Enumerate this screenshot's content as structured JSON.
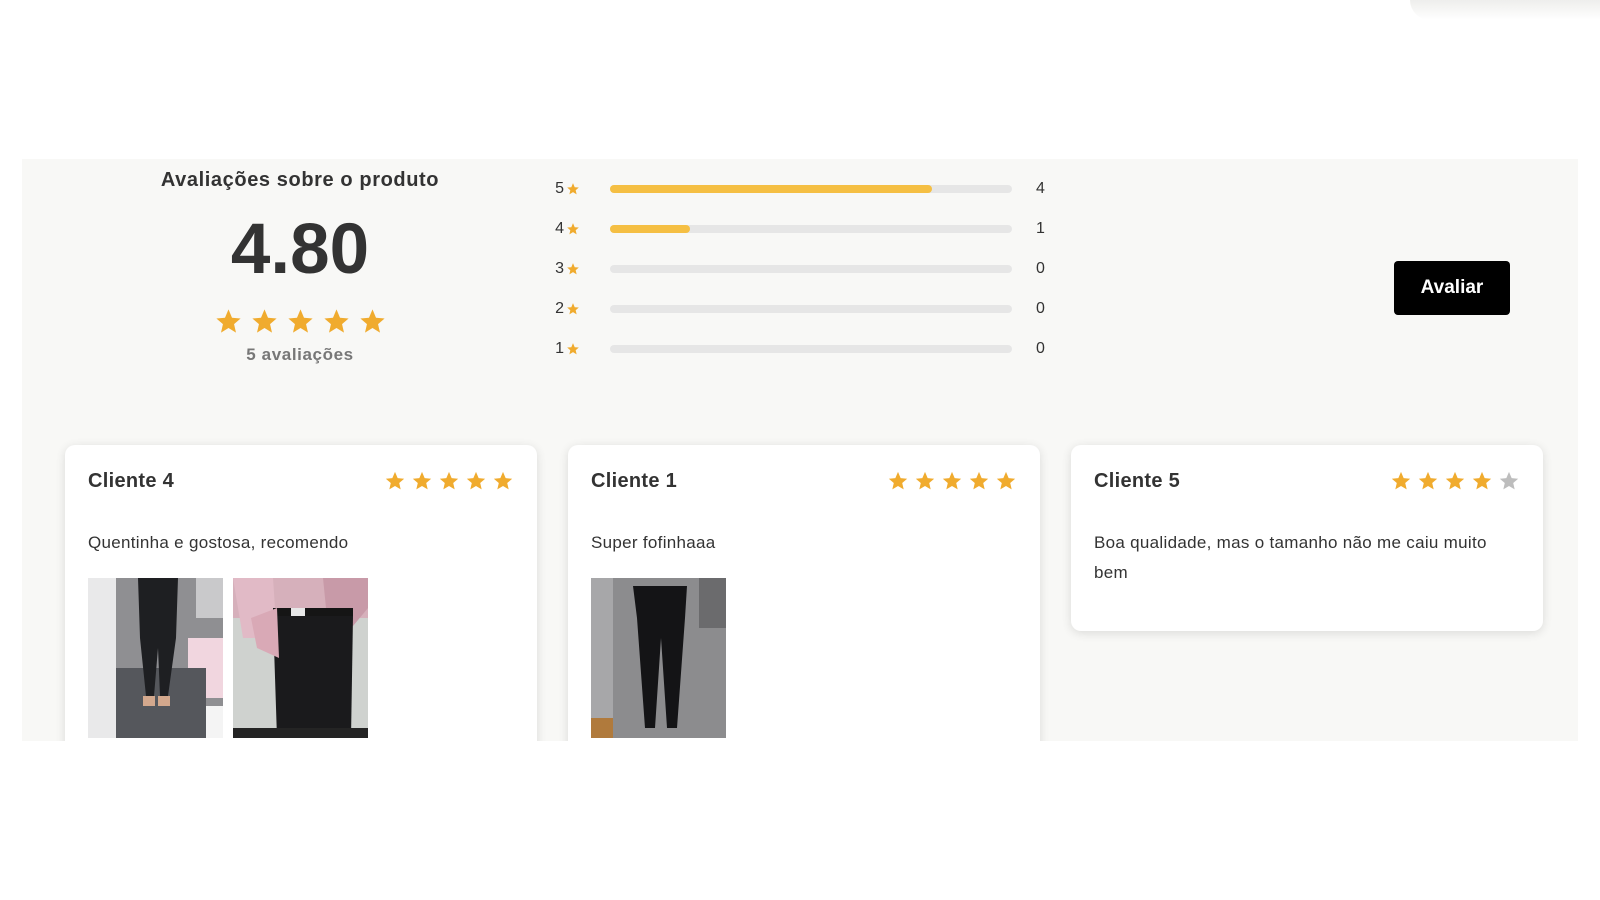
{
  "summary": {
    "title": "Avaliações sobre o produto",
    "average": "4.80",
    "rating_stars": 5,
    "count_label": "5 avaliações"
  },
  "distribution": [
    {
      "level": "5",
      "count": "4",
      "fraction": 0.8
    },
    {
      "level": "4",
      "count": "1",
      "fraction": 0.2
    },
    {
      "level": "3",
      "count": "0",
      "fraction": 0
    },
    {
      "level": "2",
      "count": "0",
      "fraction": 0
    },
    {
      "level": "1",
      "count": "0",
      "fraction": 0
    }
  ],
  "actions": {
    "review_button": "Avaliar"
  },
  "reviews": [
    {
      "name": "Cliente 4",
      "stars": 5,
      "text": "Quentinha e gostosa, recomendo",
      "photo_count": 2
    },
    {
      "name": "Cliente 1",
      "stars": 5,
      "text": "Super fofinhaaa",
      "photo_count": 1
    },
    {
      "name": "Cliente 5",
      "stars": 4,
      "text": "Boa qualidade, mas o tamanho não me caiu muito bem",
      "photo_count": 0
    }
  ],
  "colors": {
    "star_filled": "#f0ab2e",
    "star_empty": "#bdbdbd",
    "bar_fill": "#f5bf43",
    "bar_track": "#e6e6e6",
    "button_bg": "#000000",
    "panel_bg": "#f8f8f6"
  },
  "icons": {
    "star": "star-icon"
  }
}
